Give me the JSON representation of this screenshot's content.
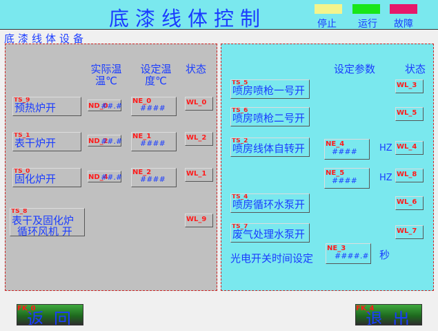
{
  "header": {
    "title": "底漆线体控制",
    "legend": [
      {
        "label": "停止",
        "color": "#f4f48c"
      },
      {
        "label": "运行",
        "color": "#19e619"
      },
      {
        "label": "故障",
        "color": "#e6196a"
      }
    ]
  },
  "section_label": "底漆线体设备",
  "left_panel": {
    "headers": {
      "actual_temp": "实际温温℃",
      "set_temp": "设定温度℃",
      "status": "状态"
    },
    "rows": [
      {
        "label": "预热炉开",
        "btn_tag": "TS_9",
        "actual_tag": "ND_0",
        "actual_value": "##.#",
        "set_tag": "NE_0",
        "set_value": "####",
        "status_tag": "WL_0"
      },
      {
        "label": "表干炉开",
        "btn_tag": "TS_1",
        "actual_tag": "ND_2",
        "actual_value": "##.#",
        "set_tag": "NE_1",
        "set_value": "####",
        "status_tag": "WL_2"
      },
      {
        "label": "固化炉开",
        "btn_tag": "TS_0",
        "actual_tag": "ND_4",
        "actual_value": "##.#",
        "set_tag": "NE_2",
        "set_value": "####",
        "status_tag": "WL_1"
      }
    ],
    "fan": {
      "label_line1": "表干及固化炉",
      "label_line2": "循环风机 开",
      "btn_tag": "TS_8",
      "status_tag": "WL_9"
    }
  },
  "right_panel": {
    "headers": {
      "set_param": "设定参数",
      "status": "状态"
    },
    "rows": [
      {
        "label": "喷房喷枪一号开",
        "btn_tag": "TS_5",
        "status_tag": "WL_3"
      },
      {
        "label": "喷房喷枪二号开",
        "btn_tag": "TS_6",
        "status_tag": "WL_5"
      },
      {
        "label": "喷房线体自转开",
        "btn_tag": "TS_2",
        "status_tag": "WL_4"
      },
      {
        "label": "喷房循环水泵开",
        "btn_tag": "TS_4",
        "status_tag": "WL_6"
      },
      {
        "label": "废气处理水泵开",
        "btn_tag": "TS_7",
        "status_tag": "WL_7"
      }
    ],
    "params": [
      {
        "tag": "NE_4",
        "value": "####",
        "unit": "HZ",
        "status_tag": "WL_4"
      },
      {
        "tag": "NE_5",
        "value": "####",
        "unit": "HZ",
        "status_tag": "WL_8"
      }
    ],
    "photo_switch": {
      "label": "光电开关时间设定",
      "tag": "NE_3",
      "value": "####.#",
      "unit": "秒"
    }
  },
  "footer": {
    "back": {
      "tag": "FK_0",
      "label": "返回"
    },
    "exit": {
      "tag": "FK_4",
      "label": "退出"
    }
  }
}
